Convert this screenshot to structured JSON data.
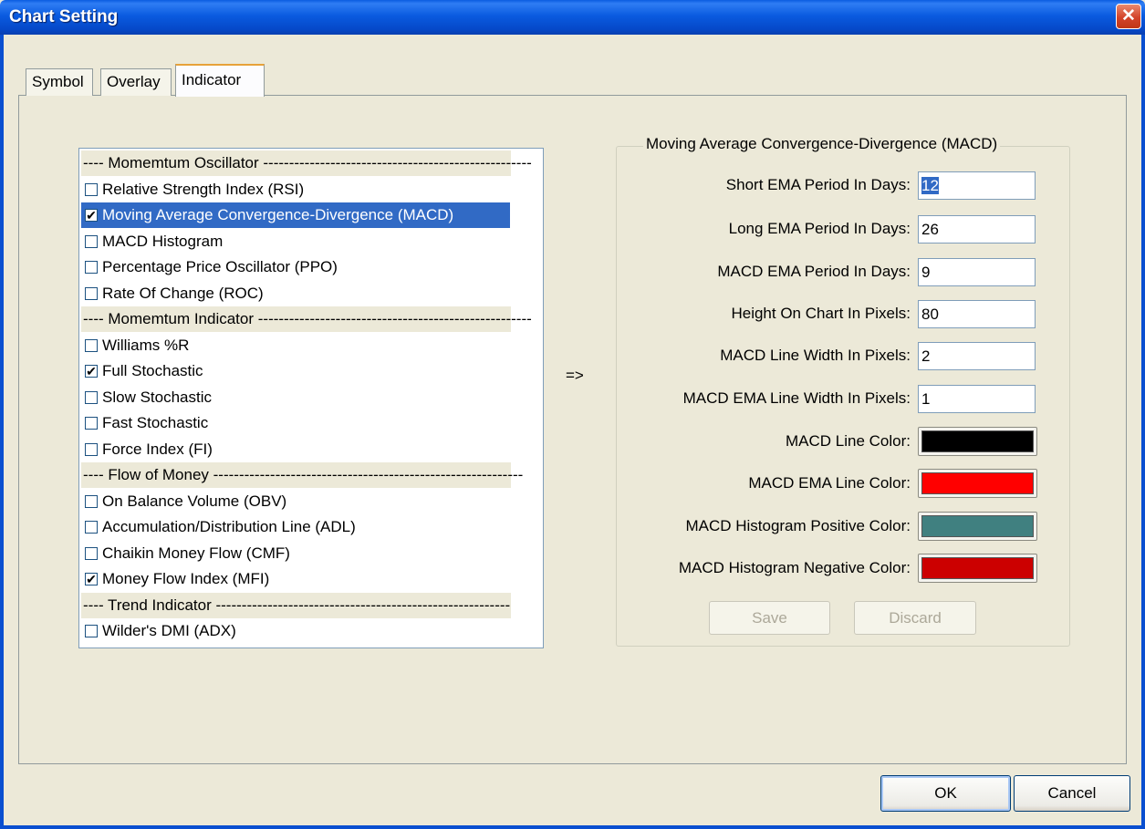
{
  "window": {
    "title": "Chart Setting"
  },
  "tabs": [
    {
      "label": "Symbol"
    },
    {
      "label": "Overlay"
    },
    {
      "label": "Indicator",
      "active": true
    }
  ],
  "indicator_list": {
    "items": [
      {
        "label": "---- Momemtum Oscillator ----------------------------------------------------",
        "section": true
      },
      {
        "label": "Relative Strength Index (RSI)",
        "checked": false
      },
      {
        "label": "Moving Average Convergence-Divergence (MACD)",
        "checked": true,
        "selected": true
      },
      {
        "label": "MACD Histogram",
        "checked": false
      },
      {
        "label": "Percentage Price Oscillator (PPO)",
        "checked": false
      },
      {
        "label": "Rate Of Change (ROC)",
        "checked": false
      },
      {
        "label": "---- Momemtum Indicator -----------------------------------------------------",
        "section": true
      },
      {
        "label": "Williams %R",
        "checked": false
      },
      {
        "label": "Full Stochastic",
        "checked": true
      },
      {
        "label": "Slow Stochastic",
        "checked": false
      },
      {
        "label": "Fast Stochastic",
        "checked": false
      },
      {
        "label": "Force Index (FI)",
        "checked": false
      },
      {
        "label": "---- Flow of Money ------------------------------------------------------------",
        "section": true
      },
      {
        "label": "On Balance Volume (OBV)",
        "checked": false
      },
      {
        "label": "Accumulation/Distribution Line (ADL)",
        "checked": false
      },
      {
        "label": "Chaikin Money Flow (CMF)",
        "checked": false
      },
      {
        "label": "Money Flow Index (MFI)",
        "checked": true
      },
      {
        "label": "---- Trend Indicator ---------------------------------------------------------",
        "section": true
      },
      {
        "label": "Wilder's DMI (ADX)",
        "checked": false
      }
    ]
  },
  "arrow_label": "=>",
  "macd_settings": {
    "group_title": "Moving Average Convergence-Divergence (MACD)",
    "short_ema_label": "Short EMA Period In Days:",
    "short_ema_value": "12",
    "long_ema_label": "Long EMA Period In Days:",
    "long_ema_value": "26",
    "macd_ema_label": "MACD EMA Period In Days:",
    "macd_ema_value": "9",
    "height_label": "Height On Chart In Pixels:",
    "height_value": "80",
    "line_width_label": "MACD Line Width In Pixels:",
    "line_width_value": "2",
    "ema_line_width_label": "MACD EMA Line Width In Pixels:",
    "ema_line_width_value": "1",
    "line_color_label": "MACD Line Color:",
    "line_color": "#000000",
    "ema_line_color_label": "MACD EMA Line Color:",
    "ema_line_color": "#ff0000",
    "hist_pos_color_label": "MACD Histogram Positive Color:",
    "hist_pos_color": "#408080",
    "hist_neg_color_label": "MACD Histogram Negative Color:",
    "hist_neg_color": "#cc0000",
    "save_label": "Save",
    "discard_label": "Discard"
  },
  "footer": {
    "ok_label": "OK",
    "cancel_label": "Cancel"
  },
  "icons": {
    "close": "close-icon",
    "scroll_up": "chevron-up-icon",
    "scroll_down": "chevron-down-icon",
    "check": "check-icon"
  }
}
